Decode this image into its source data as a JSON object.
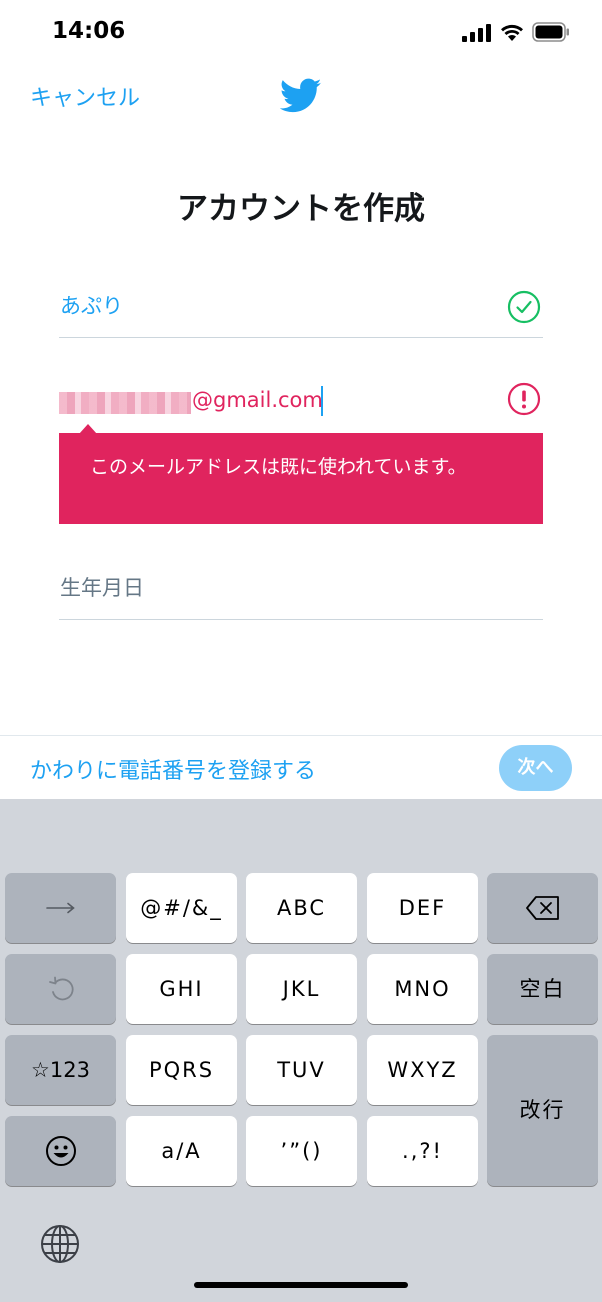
{
  "status_bar": {
    "time": "14:06"
  },
  "header": {
    "cancel_label": "キャンセル",
    "logo_icon": "twitter-bird-icon",
    "title": "アカウントを作成"
  },
  "form": {
    "name_value": "あぷり",
    "email_domain": "@gmail.com",
    "error_message": "このメールアドレスは既に使われています。",
    "birthday_placeholder": "生年月日"
  },
  "bottom_bar": {
    "phone_link": "かわりに電話番号を登録する",
    "next_label": "次へ"
  },
  "keyboard": {
    "row1": [
      "@#/&_",
      "ABC",
      "DEF"
    ],
    "row2": [
      "GHI",
      "JKL",
      "MNO"
    ],
    "row3": [
      "PQRS",
      "TUV",
      "WXYZ"
    ],
    "row4": [
      "a/A",
      "’”()",
      ".,?!"
    ],
    "space_label": "空白",
    "return_label": "改行",
    "numbers_label": "☆123"
  },
  "colors": {
    "accent": "#1da1f2",
    "error": "#e0245e",
    "success": "#17bf63",
    "next_disabled": "#8ed0f9"
  }
}
